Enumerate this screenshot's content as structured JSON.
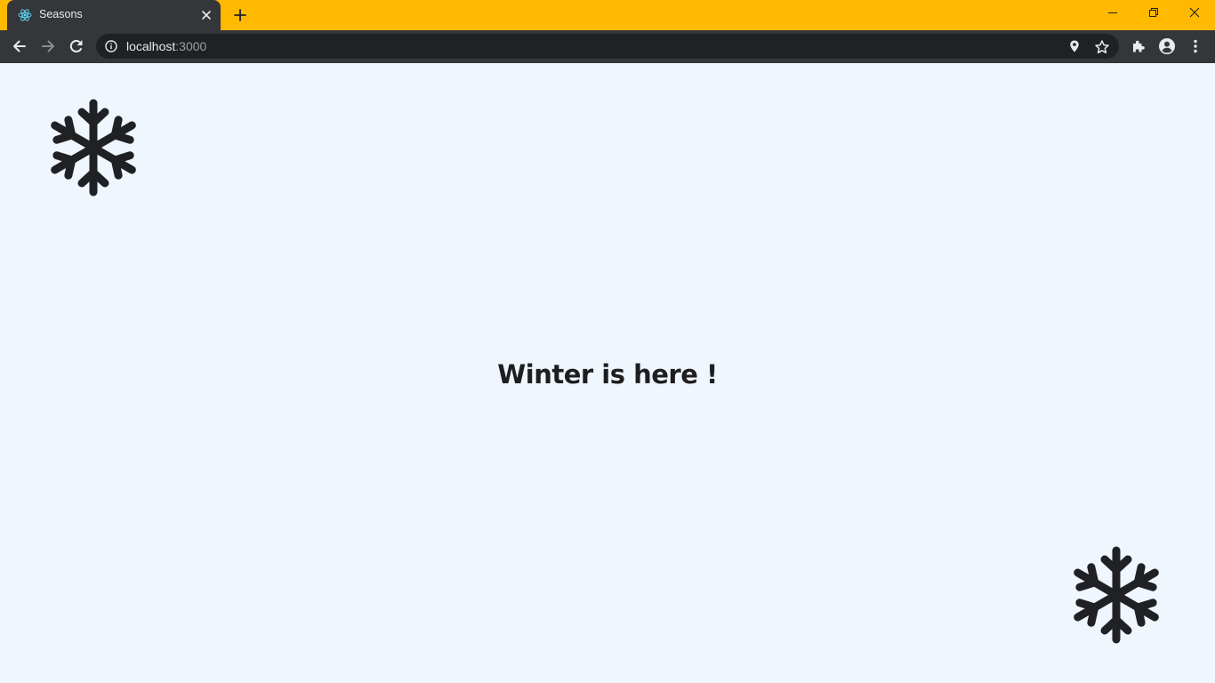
{
  "browser": {
    "tab": {
      "title": "Seasons",
      "favicon": "react-icon"
    },
    "address": {
      "host": "localhost",
      "port": ":3000"
    },
    "colors": {
      "frame": "#ffb900",
      "tab": "#35363a",
      "toolbar": "#35363a",
      "omnibox": "#202124"
    }
  },
  "page": {
    "message": "Winter is here !",
    "icon": "snowflake-icon",
    "colors": {
      "background": "#eff6fe",
      "text": "#1e1e20"
    }
  }
}
